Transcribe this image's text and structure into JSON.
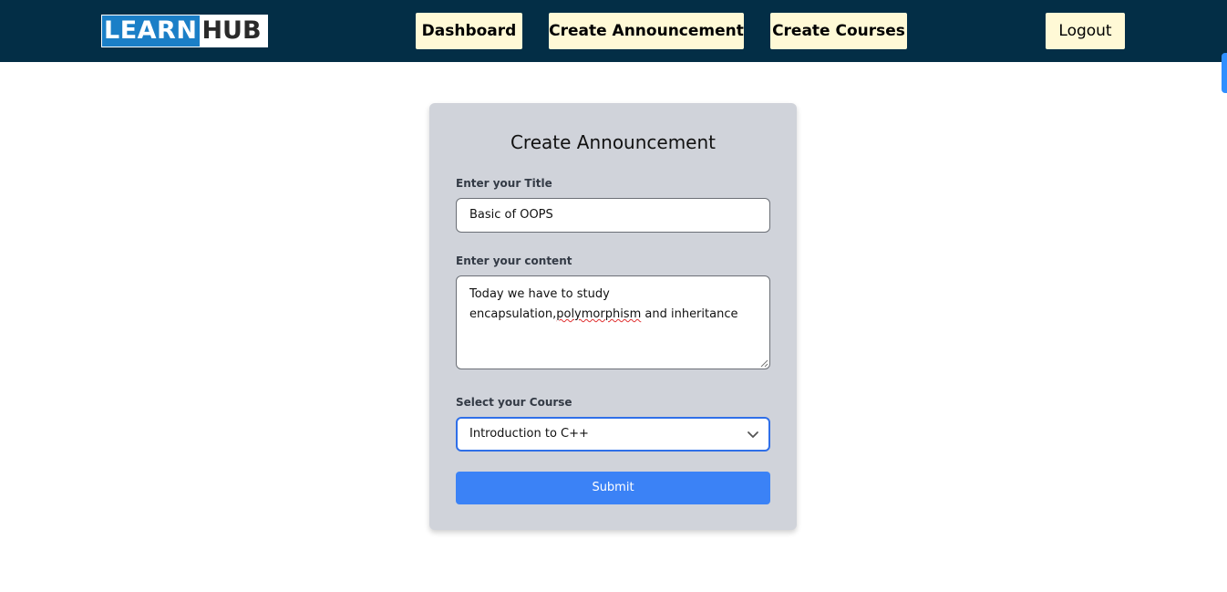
{
  "header": {
    "logo": {
      "learn": "LEARN",
      "hub": "HUB"
    },
    "nav": {
      "dashboard": "Dashboard",
      "create_announcement": "Create Announcement",
      "create_courses": "Create Courses",
      "logout": "Logout"
    }
  },
  "form": {
    "heading": "Create Announcement",
    "title_label": "Enter your Title",
    "title_value": "Basic of OOPS",
    "content_label": "Enter your content",
    "content_line1": "Today we have to study",
    "content_line2_a": "encapsulation,",
    "content_line2_b": "polymorphism",
    "content_line2_c": " and inheritance",
    "course_label": "Select your Course",
    "course_selected": "Introduction to C++",
    "submit_label": "Submit"
  },
  "colors": {
    "navbar": "#032e46",
    "nav_button": "#fff9d6",
    "card": "#d0d3da",
    "accent": "#3b82f6"
  },
  "icons": {
    "select_arrow": "chevron-down-icon"
  }
}
